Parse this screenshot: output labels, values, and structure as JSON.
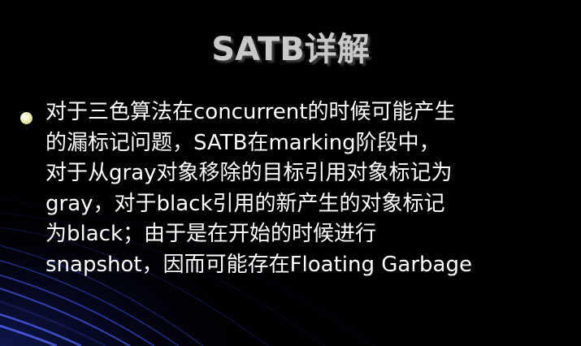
{
  "slide": {
    "title": "SATB详解",
    "bullet": {
      "lines": [
        "对于三色算法在concurrent的时候可能产生",
        "的漏标记问题，SATB在marking阶段中，",
        "对于从gray对象移除的目标引用对象标记为",
        "gray，对于black引用的新产生的对象标记",
        "为black；由于是在开始的时候进行",
        "snapshot，因而可能存在Floating Garbage"
      ]
    },
    "colors": {
      "background": "#010103",
      "text": "#ffffff",
      "title": "#c8c8c8",
      "bullet": "#f6f6c8",
      "decor_stripe": "#2a3aa0"
    }
  }
}
